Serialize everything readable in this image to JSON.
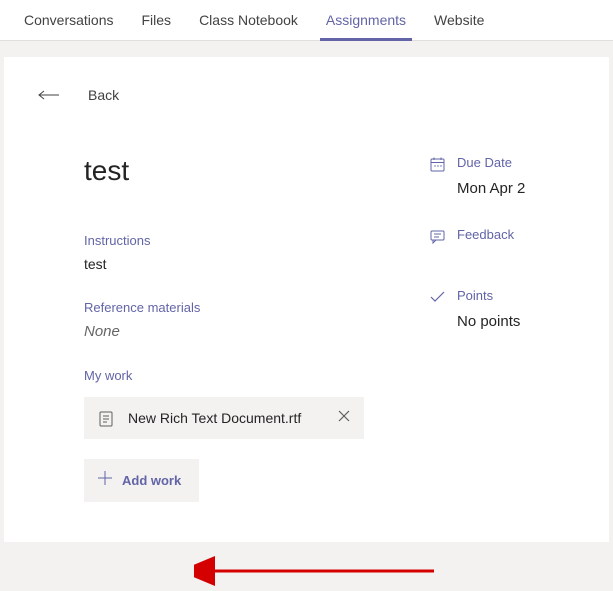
{
  "tabs": {
    "items": [
      {
        "label": "Conversations",
        "active": false
      },
      {
        "label": "Files",
        "active": false
      },
      {
        "label": "Class Notebook",
        "active": false
      },
      {
        "label": "Assignments",
        "active": true
      },
      {
        "label": "Website",
        "active": false
      }
    ]
  },
  "back": {
    "label": "Back"
  },
  "assignment": {
    "title": "test",
    "instructions_label": "Instructions",
    "instructions_value": "test",
    "reference_label": "Reference materials",
    "reference_value": "None",
    "mywork_label": "My work",
    "attachment_name": "New Rich Text Document.rtf",
    "add_work_label": "Add work"
  },
  "sidebar": {
    "due_label": "Due Date",
    "due_value": "Mon Apr 2",
    "feedback_label": "Feedback",
    "points_label": "Points",
    "points_value": "No points"
  }
}
